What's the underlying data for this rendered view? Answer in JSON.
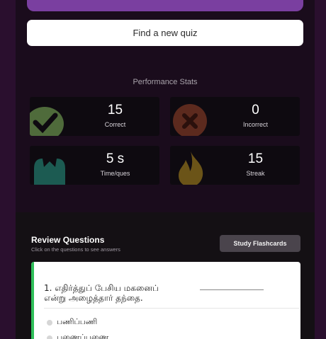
{
  "header": {
    "find_quiz_label": "Find a new quiz"
  },
  "performance": {
    "title": "Performance Stats",
    "stats": [
      {
        "value": "15",
        "label": "Correct",
        "icon": "check-icon",
        "color": "#4f6b3b"
      },
      {
        "value": "0",
        "label": "Incorrect",
        "icon": "x-icon",
        "color": "#5c2a1e"
      },
      {
        "value": "5 s",
        "label": "Time/ques",
        "icon": "hourglass-icon",
        "color": "#1c5b52"
      },
      {
        "value": "15",
        "label": "Streak",
        "icon": "flame-icon",
        "color": "#6b5418"
      }
    ]
  },
  "review": {
    "title": "Review Questions",
    "subtitle": "Click on the questions to see answers",
    "flashcards_label": "Study Flashcards",
    "question": {
      "number": "1.",
      "text_line1": "எதிர்த்துப் பேசிய மகனைப்",
      "text_line2": "என்று அழைத்தார் தந்தை.",
      "options": [
        "பணிப்பணி",
        "பணைப்பணை"
      ]
    }
  }
}
